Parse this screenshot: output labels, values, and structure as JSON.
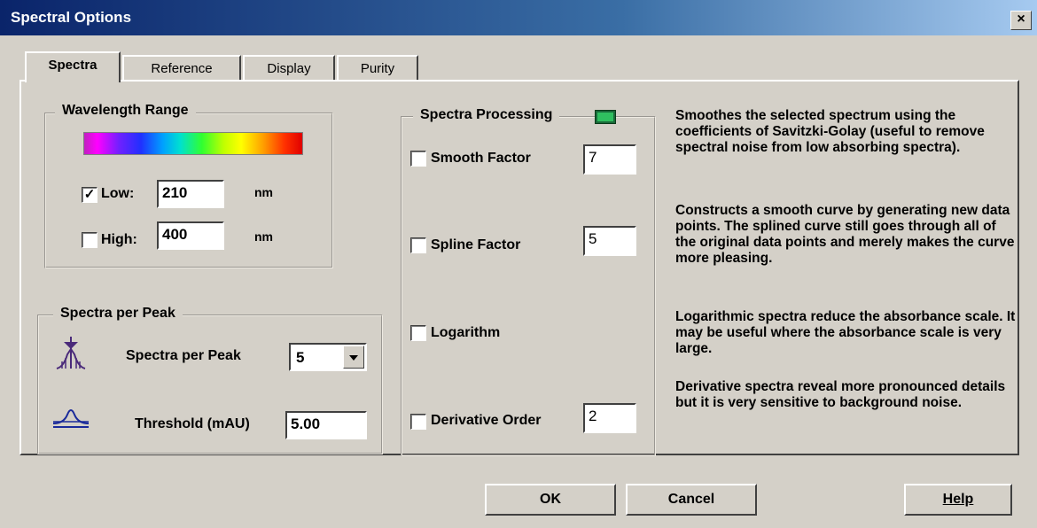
{
  "window": {
    "title": "Spectral Options",
    "close": "×"
  },
  "tabs": [
    {
      "label": "Spectra",
      "active": true
    },
    {
      "label": "Reference"
    },
    {
      "label": "Display"
    },
    {
      "label": "Purity"
    }
  ],
  "wavelength": {
    "group_label": "Wavelength Range",
    "low": {
      "label": "Low:",
      "checked": "✓",
      "value": "210",
      "unit": "nm"
    },
    "high": {
      "label": "High:",
      "checked": "",
      "value": "400",
      "unit": "nm"
    }
  },
  "peak": {
    "group_label": "Spectra per Peak",
    "spectra_label": "Spectra per Peak",
    "spectra_value": "5",
    "threshold_label": "Threshold (mAU)",
    "threshold_value": "5.00"
  },
  "processing": {
    "group_label": "Spectra Processing",
    "smooth": {
      "label": "Smooth  Factor",
      "value": "7"
    },
    "spline": {
      "label": "Spline  Factor",
      "value": "5"
    },
    "log": {
      "label": "Logarithm"
    },
    "derivative": {
      "label": "Derivative Order",
      "value": "2"
    }
  },
  "descriptions": {
    "smooth": "Smoothes the selected spectrum using the coefficients of Savitzki-Golay (useful to remove spectral noise from low absorbing spectra).",
    "spline": "Constructs a smooth curve by generating new data points. The splined curve still goes through all of the original data points and merely makes the curve more pleasing.",
    "log": "Logarithmic spectra reduce the absorbance scale. It may be useful where the absorbance scale is very large.",
    "derivative": "Derivative spectra reveal more pronounced details but it is very sensitive to background noise."
  },
  "buttons": {
    "ok": "OK",
    "cancel": "Cancel",
    "help": "Help"
  },
  "colors": {
    "titlebar": "#0a246a",
    "face": "#d4d0c8"
  },
  "icons": [
    "peak-marker-icon",
    "threshold-icon",
    "green-button-icon"
  ]
}
